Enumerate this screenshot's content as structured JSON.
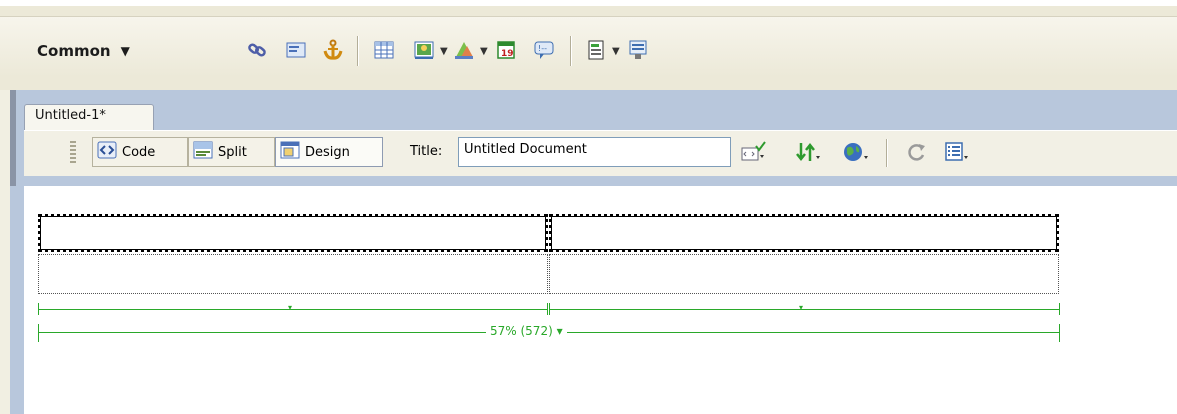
{
  "insert_bar": {
    "category": "Common",
    "category_caret": "▼",
    "items": [
      {
        "name": "hyperlink-icon"
      },
      {
        "name": "email-link-icon"
      },
      {
        "name": "named-anchor-icon"
      },
      {
        "name": "table-icon"
      },
      {
        "name": "image-icon"
      },
      {
        "name": "media-icon"
      },
      {
        "name": "date-icon"
      },
      {
        "name": "comment-icon"
      },
      {
        "name": "templates-icon"
      },
      {
        "name": "tag-chooser-icon"
      }
    ]
  },
  "document": {
    "tab_title": "Untitled-1*",
    "views": {
      "code": "Code",
      "split": "Split",
      "design": "Design"
    },
    "title_label": "Title:",
    "title_value": "Untitled Document",
    "toolbar_icons": [
      "browser-check-icon",
      "file-management-icon",
      "preview-browser-icon",
      "refresh-icon",
      "view-options-icon"
    ]
  },
  "table": {
    "width_label": "57% (572) ▾",
    "column_caret": "▾"
  },
  "colors": {
    "guide": "#2aa82a",
    "doc_frame": "#b8c7dc"
  }
}
